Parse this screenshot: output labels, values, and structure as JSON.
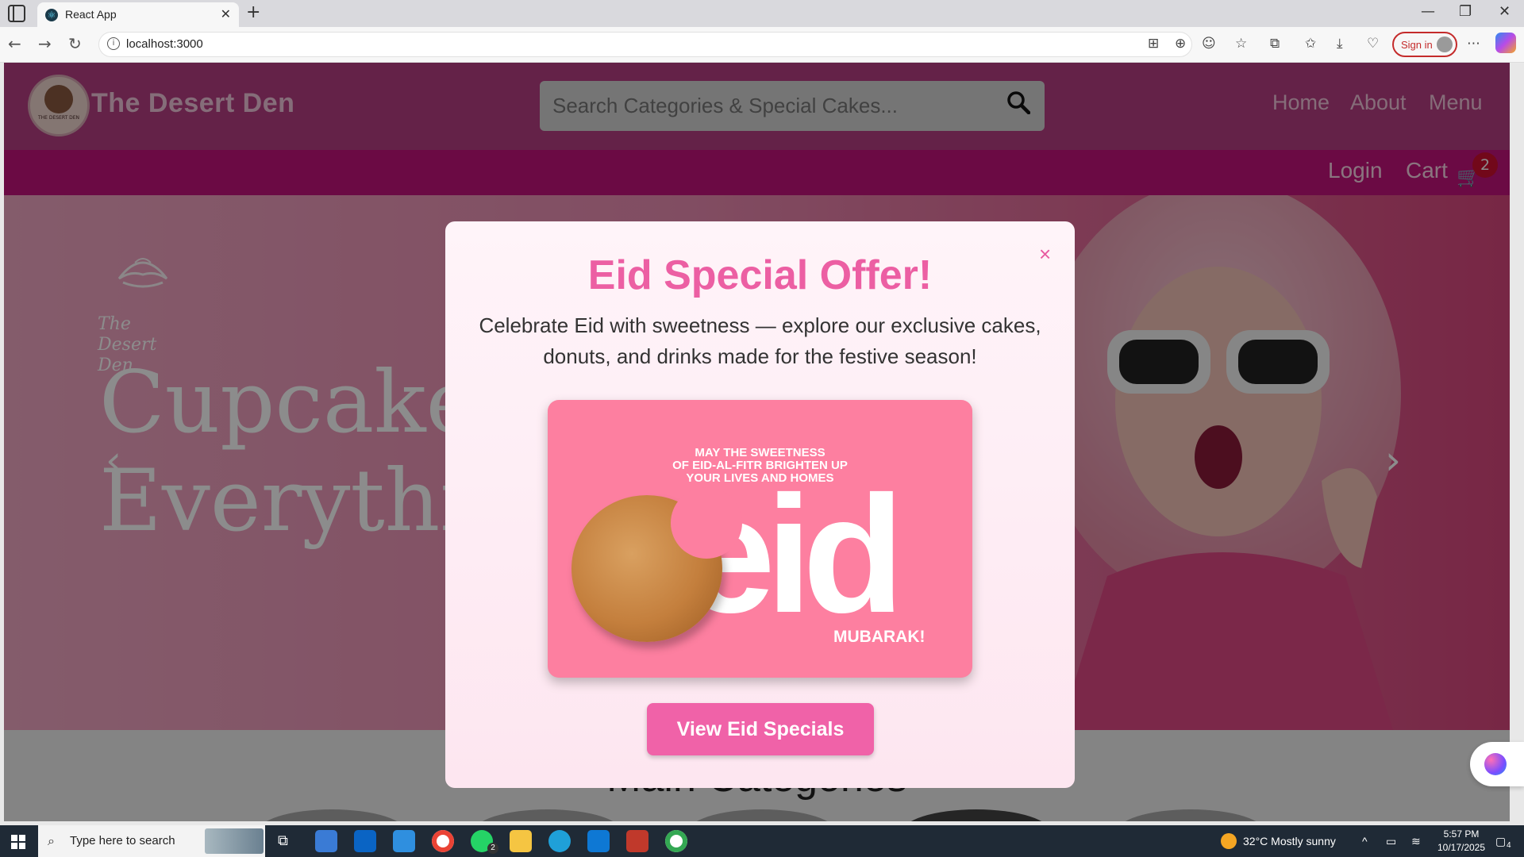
{
  "browser": {
    "tab_title": "React App",
    "url": "localhost:3000",
    "signin_label": "Sign in"
  },
  "site": {
    "logo_tiny_text": "THE DESERT DEN",
    "brand": "The Desert Den",
    "search_placeholder": "Search Categories & Special Cakes...",
    "nav": [
      "Home",
      "About",
      "Menu"
    ],
    "subnav": {
      "login": "Login",
      "cart": "Cart",
      "cart_count": "2"
    },
    "hero": {
      "logo_script": "The Desert Den",
      "tagline_line1": "Cupcakes",
      "tagline_line2": "Everythi"
    },
    "section_heading": "Main Categories"
  },
  "modal": {
    "close": "×",
    "title": "Eid Special Offer!",
    "description": "Celebrate Eid with sweetness — explore our exclusive cakes, donuts, and drinks made for the festive season!",
    "promo": {
      "line1": "MAY THE SWEETNESS",
      "line2": "OF EID-AL-FITR BRIGHTEN UP",
      "line3": "YOUR LIVES AND HOMES",
      "big": "eid",
      "sub": "MUBARAK!"
    },
    "cta": "View Eid Specials"
  },
  "taskbar": {
    "search_placeholder": "Type here to search",
    "whatsapp_badge": "2",
    "weather": "32°C  Mostly sunny",
    "time": "5:57 PM",
    "date": "10/17/2025",
    "notif_count": "4"
  },
  "colors": {
    "brand_pink": "#ec5fa3",
    "header": "#b73e84",
    "subnav": "#c3137c",
    "cta": "#f062a8"
  }
}
